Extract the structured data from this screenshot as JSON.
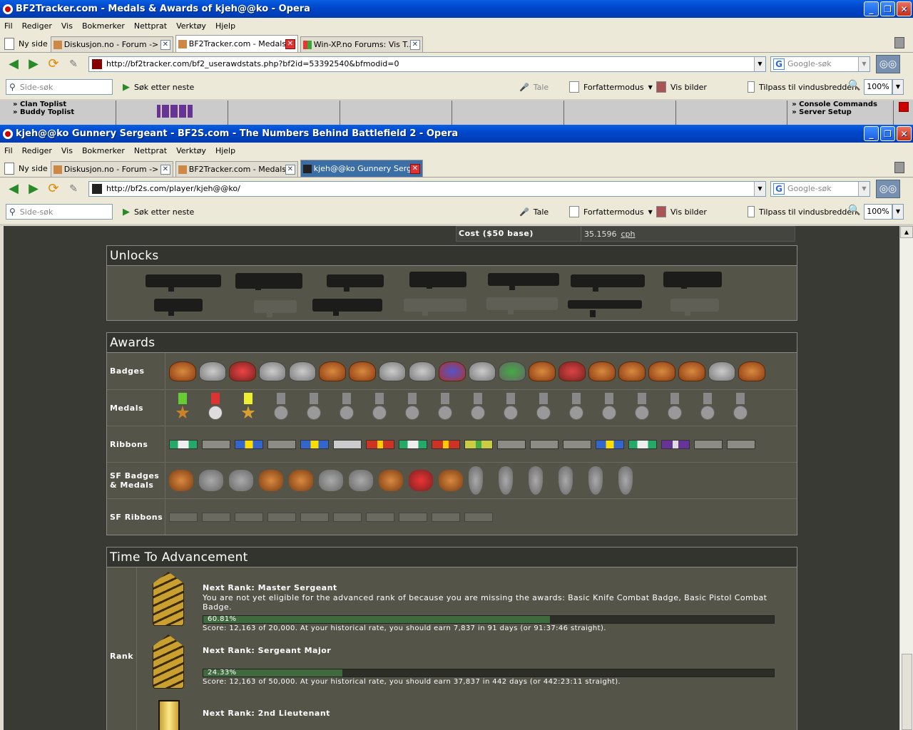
{
  "back_window": {
    "title": "BF2Tracker.com - Medals & Awards of kjeh@@ko - Opera",
    "menu": [
      "Fil",
      "Rediger",
      "Vis",
      "Bokmerker",
      "Nettprat",
      "Verktøy",
      "Hjelp"
    ],
    "new_tab": "Ny side",
    "tabs": [
      {
        "label": "Diskusjon.no - Forum -> ..."
      },
      {
        "label": "BF2Tracker.com - Medals..."
      },
      {
        "label": "Win-XP.no Forums: Vis T..."
      }
    ],
    "url": "http://bf2tracker.com/bf2_userawdstats.php?bf2id=53392540&bfmodid=0",
    "search_placeholder": "Google-søk",
    "side_search": "Side-søk",
    "find_next": "Søk etter neste",
    "speech": "Tale",
    "author_mode": "Forfattermodus",
    "show_images": "Vis bilder",
    "fit_width": "Tilpass til vindusbredden",
    "zoom": "100%",
    "strip_left": [
      "» Clan Toplist",
      "» Buddy Toplist"
    ],
    "strip_right": [
      "» Console Commands",
      "» Server Setup"
    ]
  },
  "front_window": {
    "title": "kjeh@@ko Gunnery Sergeant - BF2S.com - The Numbers Behind Battlefield 2 - Opera",
    "menu": [
      "Fil",
      "Rediger",
      "Vis",
      "Bokmerker",
      "Nettprat",
      "Verktøy",
      "Hjelp"
    ],
    "new_tab": "Ny side",
    "tabs": [
      {
        "label": "Diskusjon.no - Forum -> ..."
      },
      {
        "label": "BF2Tracker.com - Medals..."
      },
      {
        "label": "kjeh@@ko Gunnery Serg..."
      }
    ],
    "url": "http://bf2s.com/player/kjeh@@ko/",
    "search_placeholder": "Google-søk",
    "side_search": "Side-søk",
    "find_next": "Søk etter neste",
    "speech": "Tale",
    "author_mode": "Forfattermodus",
    "show_images": "Vis bilder",
    "fit_width": "Tilpass til vindusbredden",
    "zoom": "100%"
  },
  "page": {
    "cost_label": "Cost ($50 base)",
    "cost_value": "35.1596",
    "cost_unit": "cph",
    "unlocks_title": "Unlocks",
    "awards_title": "Awards",
    "award_rows": {
      "badges": "Badges",
      "medals": "Medals",
      "ribbons": "Ribbons",
      "sf_badges": "SF Badges & Medals",
      "sf_ribbons": "SF Ribbons"
    },
    "tta_title": "Time To Advancement",
    "rank_label": "Rank",
    "next_ranks": [
      {
        "heading": "Next Rank: Master Sergeant",
        "desc": "You are not yet eligible for the advanced rank of because you are missing the awards: Basic Knife Combat Badge, Basic Pistol Combat Badge.",
        "percent_label": "60.81%",
        "percent": 60.81,
        "score": "Score: 12,163 of 20,000. At your historical rate, you should earn 7,837 in 91 days (or 91:37:46 straight)."
      },
      {
        "heading": "Next Rank: Sergeant Major",
        "desc": "",
        "percent_label": "24.33%",
        "percent": 24.33,
        "score": "Score: 12,163 of 50,000. At your historical rate, you should earn 37,837 in 442 days (or 442:23:11 straight)."
      },
      {
        "heading": "Next Rank: 2nd Lieutenant",
        "desc": "",
        "percent_label": "",
        "percent": 0,
        "score": ""
      }
    ]
  }
}
